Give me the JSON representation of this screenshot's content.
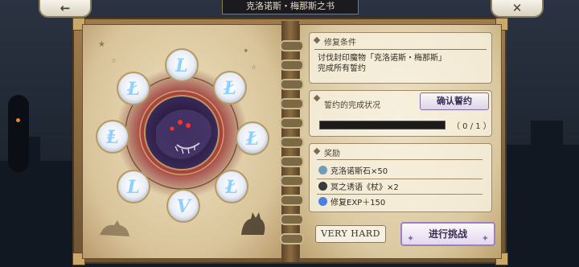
{
  "header": {
    "title": "克洛诺斯・梅那斯之书"
  },
  "nav": {
    "back_glyph": "←",
    "close_glyph": "✕"
  },
  "conditions": {
    "heading": "修复条件",
    "line1": "讨伐封印魔物「克洛诺斯・梅那斯」",
    "line2": "完成所有誓约"
  },
  "pledge": {
    "heading": "誓约的完成状况",
    "confirm_label": "确认誓约",
    "progress_text": "（ 0 / 1 ）",
    "progress_fraction": 0
  },
  "rewards": {
    "heading": "奖励",
    "items": [
      {
        "label": "克洛诺斯石×50",
        "icon": "stone-icon",
        "color": "#6f9fb8"
      },
      {
        "label": "冥之诱语《杖》×2",
        "icon": "staff-icon",
        "color": "#3a3a3a"
      },
      {
        "label": "修复EXP＋150",
        "icon": "exp-icon",
        "color": "#4c7fe0"
      }
    ]
  },
  "difficulty": {
    "label": "VERY HARD"
  },
  "challenge": {
    "label": "进行挑战"
  },
  "colors": {
    "accent": "#9d7fc4",
    "progress_bg": "#1d1b1a",
    "rune": "#8fd0ff"
  }
}
